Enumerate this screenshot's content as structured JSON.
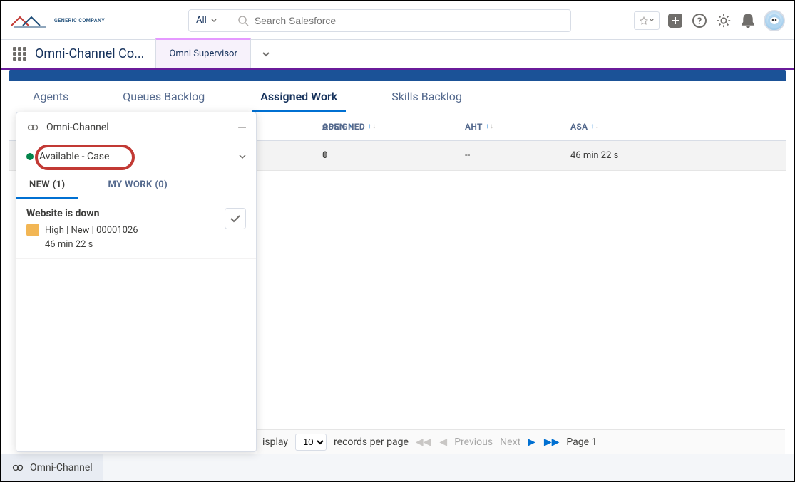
{
  "header": {
    "logo_text": "GENERIC COMPANY",
    "search_scope": "All",
    "search_placeholder": "Search Salesforce"
  },
  "appnav": {
    "app_name": "Omni-Channel Co...",
    "tab": "Omni Supervisor"
  },
  "subtabs": {
    "agents": "Agents",
    "queues": "Queues Backlog",
    "assigned": "Assigned Work",
    "skills": "Skills Backlog"
  },
  "table": {
    "headers": {
      "assigned": "ASSIGNED",
      "open": "OPEN",
      "aht": "AHT",
      "asa": "ASA"
    },
    "row": {
      "assigned": "1",
      "open": "0",
      "aht": "--",
      "asa": "46 min 22 s"
    }
  },
  "pagination": {
    "display_label": "isplay",
    "per_page_value": "10",
    "per_page_label": "records per page",
    "previous": "Previous",
    "next": "Next",
    "page_label": "Page 1"
  },
  "omni": {
    "title": "Omni-Channel",
    "status": "Available - Case",
    "tab_new": "NEW (1)",
    "tab_mywork": "MY WORK (0)",
    "item": {
      "title": "Website is down",
      "meta": "High | New | 00001026",
      "time": "46 min 22 s"
    }
  },
  "footer": {
    "omni": "Omni-Channel"
  }
}
